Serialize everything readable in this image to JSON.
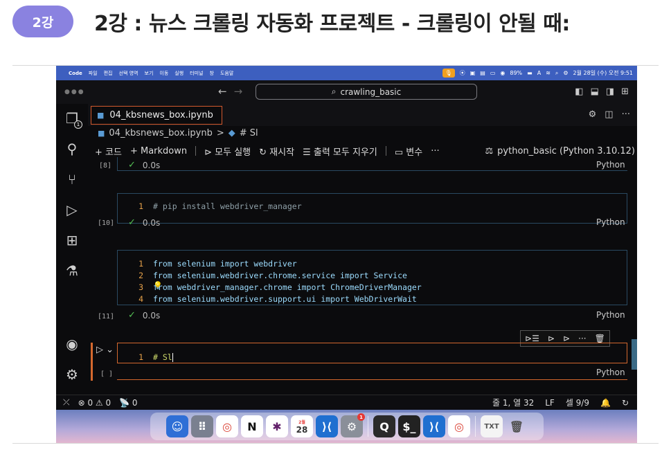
{
  "lesson": {
    "badge": "2강",
    "title": "2강 : 뉴스 크롤링 자동화 프로젝트 - 크롤링이 안될 때:"
  },
  "menubar": {
    "items": [
      "Code",
      "파일",
      "편집",
      "선택 영역",
      "보기",
      "이동",
      "실행",
      "터미널",
      "창",
      "도움말"
    ],
    "battery": "89%",
    "input": "A",
    "datetime": "2월 28일 (수) 오전 9:51"
  },
  "titlebar": {
    "search": "crawling_basic"
  },
  "tab": {
    "filename": "04_kbsnews_box.ipynb"
  },
  "breadcrumb": {
    "file": "04_kbsnews_box.ipynb",
    "separator": ">",
    "section": "# Sl"
  },
  "toolbar": {
    "code": "+ 코드",
    "markdown": "+ Markdown",
    "run_all": "모두 실행",
    "restart": "재시작",
    "clear_outputs": "출력 모두 지우기",
    "variables": "변수",
    "more": "···",
    "kernel": "python_basic (Python 3.10.12)"
  },
  "cells": [
    {
      "count": "[8]",
      "time": "0.0s",
      "lang": "Python"
    },
    {
      "count": "[10]",
      "time": "0.0s",
      "lang": "Python",
      "lines": [
        "# pip install webdriver_manager"
      ]
    },
    {
      "count": "[11]",
      "time": "0.0s",
      "lang": "Python",
      "lines": [
        "from selenium import webdriver",
        "from selenium.webdriver.chrome.service import Service",
        "from webdriver_manager.chrome import ChromeDriverManager",
        "from selenium.webdriver.support.ui import WebDriverWait"
      ]
    },
    {
      "count": "[ ]",
      "lang": "Python",
      "lines": [
        "# Sl"
      ]
    }
  ],
  "line_numbers": [
    "1",
    "2",
    "3",
    "4"
  ],
  "statusbar": {
    "problems": "⊗ 0 ⚠ 0",
    "ports": "0",
    "position": "줄 1, 열 32",
    "eol": "LF",
    "cells": "셀 9/9"
  },
  "dock": {
    "calendar_month": "2월",
    "calendar_day": "28",
    "badge": "1"
  },
  "colors": {
    "menubar": "#3d5fbf",
    "accent_border": "#d45a2e",
    "check": "#55c255"
  }
}
